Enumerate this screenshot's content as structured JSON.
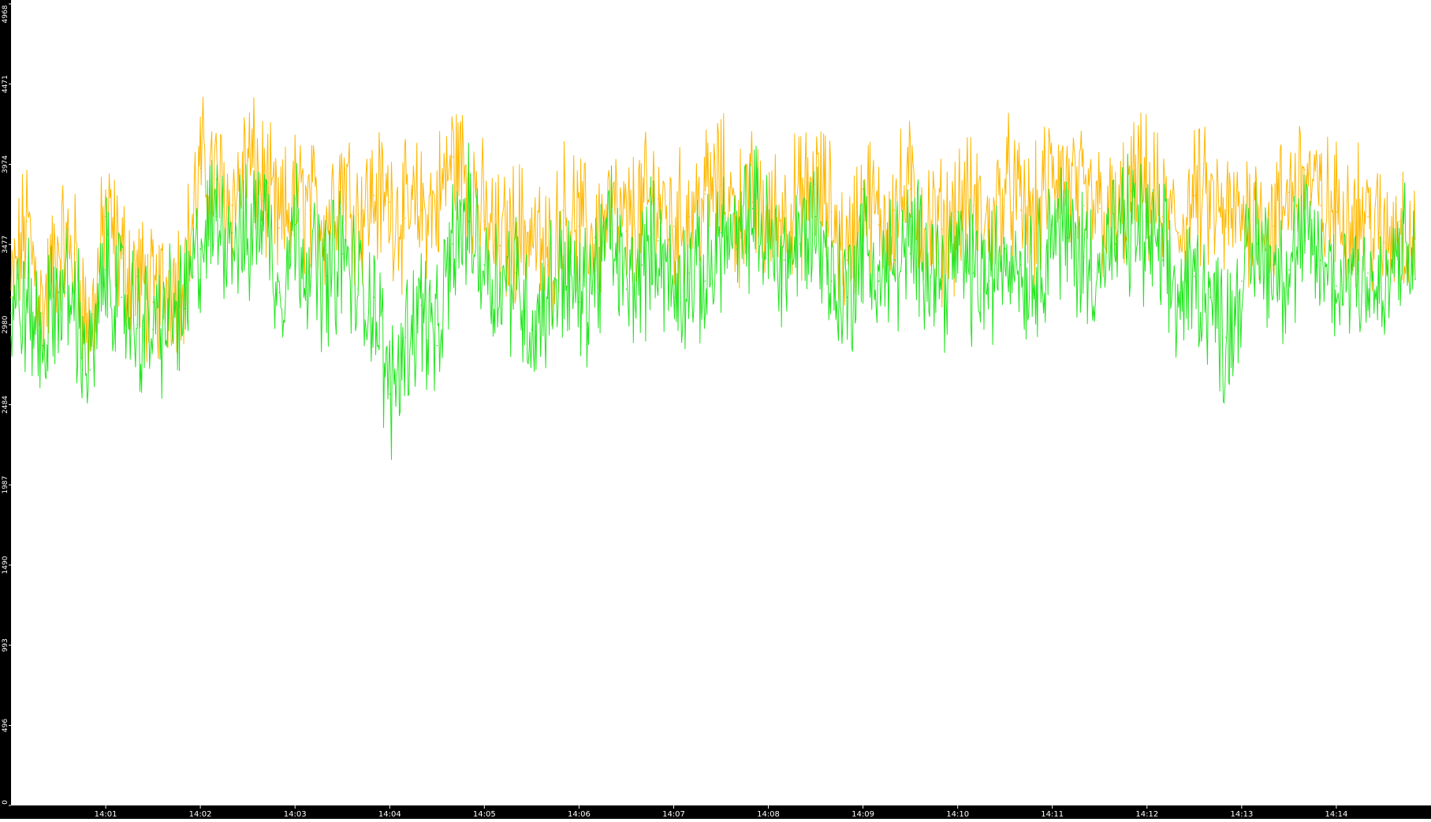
{
  "chart_data": {
    "type": "line",
    "title": "",
    "xlabel": "",
    "ylabel": "",
    "x_ticks": [
      "14:01",
      "14:02",
      "14:03",
      "14:04",
      "14:05",
      "14:06",
      "14:07",
      "14:08",
      "14:09",
      "14:10",
      "14:11",
      "14:12",
      "14:13",
      "14:14"
    ],
    "y_ticks": [
      0,
      496,
      993,
      1490,
      1987,
      2484,
      2980,
      3477,
      3974,
      4471,
      4968
    ],
    "ylim": [
      0,
      4968
    ],
    "xlim": [
      "14:00:00",
      "14:15:00"
    ],
    "grid": false,
    "legend": "none",
    "background_color": "#ffffff",
    "axis_panel_color": "#000000",
    "series": [
      {
        "color": "#ffb800",
        "sample_interval_seconds": 10,
        "values": [
          3150,
          3620,
          3050,
          3480,
          3420,
          2900,
          3650,
          3390,
          3280,
          3120,
          3230,
          3320,
          3950,
          3880,
          3720,
          4000,
          3850,
          3580,
          3760,
          3690,
          3650,
          3920,
          3660,
          3780,
          3740,
          3640,
          3690,
          3720,
          4020,
          3930,
          3620,
          3470,
          3580,
          3560,
          3350,
          3690,
          3590,
          3520,
          3680,
          3560,
          3710,
          3760,
          3590,
          3650,
          3790,
          3850,
          3640,
          3740,
          3610,
          3680,
          3720,
          3850,
          3680,
          3380,
          3820,
          3600,
          3690,
          3820,
          3580,
          3570,
          3680,
          3720,
          3540,
          3850,
          3690,
          3620,
          3950,
          3850,
          3720,
          3700,
          3580,
          3810,
          3820,
          3650,
          3550,
          3780,
          3710,
          3620,
          3660,
          3730,
          3590,
          3800,
          3940,
          3720,
          3680,
          3700,
          3650,
          3490,
          3620,
          3510
        ]
      },
      {
        "color": "#22e61e",
        "sample_interval_seconds": 10,
        "values": [
          3050,
          3100,
          2850,
          3180,
          3120,
          2700,
          3320,
          3150,
          2980,
          2950,
          3020,
          3080,
          3450,
          3650,
          3550,
          3480,
          3750,
          3180,
          3600,
          3350,
          3280,
          3420,
          3200,
          3150,
          2550,
          2900,
          3100,
          2850,
          3480,
          3620,
          3350,
          3240,
          3300,
          2950,
          3150,
          3350,
          3120,
          3270,
          3560,
          3200,
          3350,
          3500,
          3150,
          3300,
          3250,
          3550,
          3450,
          3700,
          3480,
          3380,
          3480,
          3650,
          3250,
          3150,
          3500,
          3250,
          3380,
          3420,
          3450,
          3280,
          3420,
          3300,
          3250,
          3450,
          3350,
          3300,
          3600,
          3520,
          3400,
          3350,
          3480,
          3600,
          3520,
          3380,
          3120,
          3280,
          3150,
          2900,
          3250,
          3480,
          3350,
          3320,
          3500,
          3380,
          3220,
          3350,
          3300,
          3080,
          3480,
          3260
        ]
      }
    ]
  }
}
